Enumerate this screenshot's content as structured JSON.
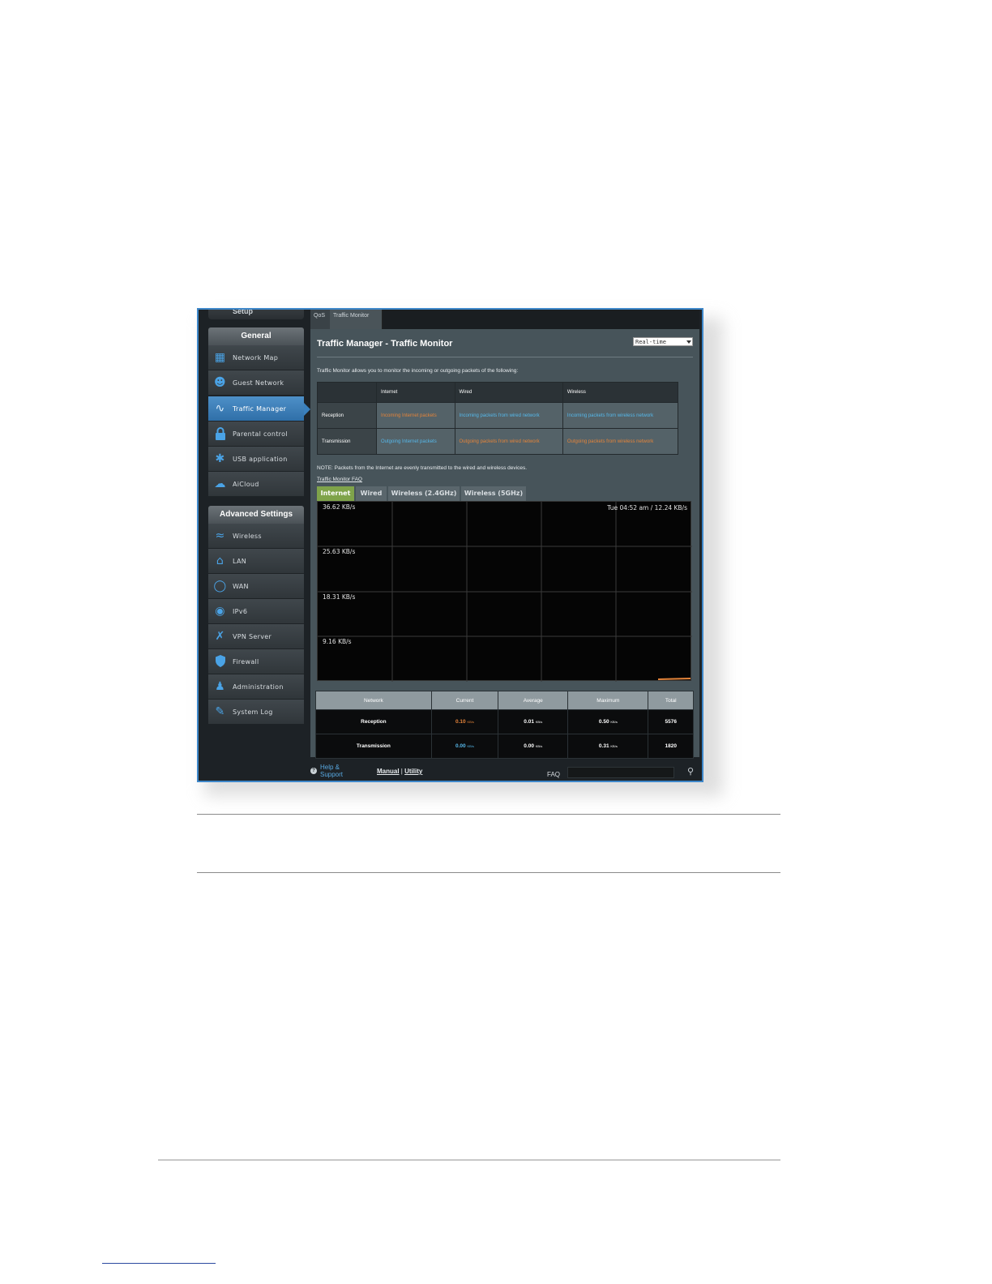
{
  "sidebar": {
    "setup_label": "Setup",
    "general_heading": "General",
    "general_items": [
      {
        "label": "Network Map",
        "icon": "network-map-icon"
      },
      {
        "label": "Guest Network",
        "icon": "guest-network-icon"
      },
      {
        "label": "Traffic Manager",
        "icon": "traffic-manager-icon",
        "active": true
      },
      {
        "label": "Parental control",
        "icon": "lock-icon"
      },
      {
        "label": "USB application",
        "icon": "puzzle-icon"
      },
      {
        "label": "AiCloud",
        "icon": "cloud-icon"
      }
    ],
    "advanced_heading": "Advanced Settings",
    "advanced_items": [
      {
        "label": "Wireless",
        "icon": "wireless-icon"
      },
      {
        "label": "LAN",
        "icon": "home-icon"
      },
      {
        "label": "WAN",
        "icon": "globe-icon"
      },
      {
        "label": "IPv6",
        "icon": "ipv6-globe-icon"
      },
      {
        "label": "VPN Server",
        "icon": "vpn-icon"
      },
      {
        "label": "Firewall",
        "icon": "shield-icon"
      },
      {
        "label": "Administration",
        "icon": "admin-user-icon"
      },
      {
        "label": "System Log",
        "icon": "log-edit-icon"
      }
    ]
  },
  "top_tabs": [
    "QoS",
    "Traffic Monitor"
  ],
  "main": {
    "title": "Traffic Manager - Traffic Monitor",
    "mode_select": "Real-time",
    "intro": "Traffic Monitor allows you to monitor the incoming or outgoing packets of the following:",
    "info_table": {
      "headers": [
        "",
        "Internet",
        "Wired",
        "Wireless"
      ],
      "rows": [
        {
          "label": "Reception",
          "cells": [
            "Incoming Internet packets",
            "Incoming packets from wired network",
            "Incoming packets from wireless network"
          ]
        },
        {
          "label": "Transmission",
          "cells": [
            "Outgoing Internet packets",
            "Outgoing packets from wired network",
            "Outgoing packets from wireless network"
          ]
        }
      ]
    },
    "note": "NOTE: Packets from the Internet are evenly transmitted to the wired and wireless devices.",
    "faq_link": "Traffic Monitor FAQ",
    "graph_tabs": [
      "Internet",
      "Wired",
      "Wireless (2.4GHz)",
      "Wireless (5GHz)"
    ],
    "graph": {
      "y_labels": [
        "36.62 KB/s",
        "25.63 KB/s",
        "18.31 KB/s",
        "9.16 KB/s"
      ],
      "time_readout": "Tue 04:52 am / 12.24 KB/s"
    },
    "stats": {
      "headers": [
        "Network",
        "Current",
        "Average",
        "Maximum",
        "Total"
      ],
      "rows": [
        {
          "label": "Reception",
          "current": "0.10",
          "average": "0.01",
          "maximum": "0.50",
          "total": "5576"
        },
        {
          "label": "Transmission",
          "current": "0.00",
          "average": "0.00",
          "maximum": "0.31",
          "total": "1820"
        }
      ],
      "unit": "KB/s"
    }
  },
  "help": {
    "label": "Help & Support",
    "manual": "Manual",
    "separator": "|",
    "utility": "Utility",
    "faq_label": "FAQ"
  },
  "colors": {
    "active_nav": "#3a80bd",
    "active_graph_tab": "#7fa34a",
    "internet_highlight": "#e4843a",
    "link_blue": "#56b8ea"
  }
}
